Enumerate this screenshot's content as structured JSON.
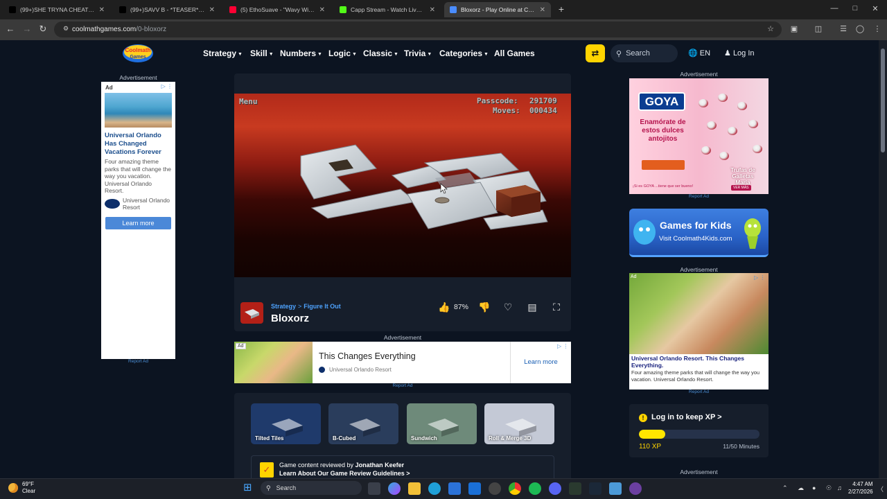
{
  "browser": {
    "tabs": [
      {
        "title": "(99+)SHE TRYNA CHEAT ON BI",
        "favicon_color": "#000000"
      },
      {
        "title": "(99+)SAVV B - *TEASER* (Official",
        "favicon_color": "#000000"
      },
      {
        "title": "(5) EthoSuave - \"Wavy Wit Num",
        "favicon_color": "#ff0033"
      },
      {
        "title": "Capp Stream - Watch Live on K",
        "favicon_color": "#53fc18"
      },
      {
        "title": "Bloxorz - Play Online at Cool",
        "favicon_color": "#4a8cff"
      }
    ],
    "new_tab_label": "+",
    "url_host": "coolmathgames.com",
    "url_path": "/0-bloxorz"
  },
  "site": {
    "logo_text": "Coolmath Games",
    "nav": [
      {
        "label": "Strategy",
        "dropdown": true
      },
      {
        "label": "Skill",
        "dropdown": true
      },
      {
        "label": "Numbers",
        "dropdown": true
      },
      {
        "label": "Logic",
        "dropdown": true
      },
      {
        "label": "Classic",
        "dropdown": true
      },
      {
        "label": "Trivia",
        "dropdown": true
      },
      {
        "label": "Categories",
        "dropdown": true
      },
      {
        "label": "All Games",
        "dropdown": false
      }
    ],
    "search_label": "Search",
    "lang_label": "EN",
    "login_label": "Log In",
    "accent_color": "#ffd400"
  },
  "ads": {
    "label": "Advertisement",
    "report": "Report Ad",
    "left": {
      "tag": "Ad",
      "headline": "Universal Orlando Has Changed Vacations Forever",
      "body": "Four amazing theme parks that will change the way you vacation. Universal Orlando Resort.",
      "advertiser": "Universal Orlando Resort",
      "cta": "Learn more"
    },
    "banner": {
      "tag": "Ad",
      "headline": "This Changes Everything",
      "advertiser": "Universal Orlando Resort",
      "cta": "Learn more"
    },
    "goya": {
      "brand": "GOYA",
      "text": "Enamórate de estos dulces antojitos",
      "product": "Trufas de Galletas María",
      "footer": "¡Si es GOYA ...tiene que ser bueno!",
      "cta": "VER MÁS"
    },
    "kids": {
      "title": "Games for Kids",
      "subtitle": "Visit Coolmath4Kids.com"
    },
    "right": {
      "tag": "Ad",
      "headline": "Universal Orlando Resort. This Changes Everything.",
      "body": "Four amazing theme parks that will change the way you vacation. Universal Orlando Resort."
    }
  },
  "game": {
    "menu_label": "Menu",
    "passcode_label": "Passcode:",
    "passcode": "291709",
    "moves_label": "Moves:",
    "moves": "000434",
    "breadcrumb_category": "Strategy",
    "breadcrumb_sub": "Figure It Out",
    "breadcrumb_sep": ">",
    "title": "Bloxorz",
    "like_percent": "87%"
  },
  "related": [
    {
      "title": "Tilted Tiles",
      "bg": "#1f3a6b"
    },
    {
      "title": "B-Cubed",
      "bg": "#2a3d5c"
    },
    {
      "title": "Sundwich",
      "bg": "#6e8a7a"
    },
    {
      "title": "Roll & Merge 3D",
      "bg": "#c4c9d6"
    }
  ],
  "review": {
    "prefix": "Game content reviewed by",
    "reviewer": "Jonathan Keefer",
    "link": "Learn About Our Game Review Guidelines",
    "link_arrow": ">"
  },
  "xp": {
    "title": "Log in to keep XP",
    "title_arrow": ">",
    "xp_label": "110 XP",
    "minutes_label": "11/50 Minutes",
    "progress": 0.22,
    "bar_color": "#ffe600"
  },
  "taskbar": {
    "temp": "69°F",
    "condition": "Clear",
    "search_label": "Search",
    "time": "4:47 AM",
    "date": "2/27/2026"
  }
}
